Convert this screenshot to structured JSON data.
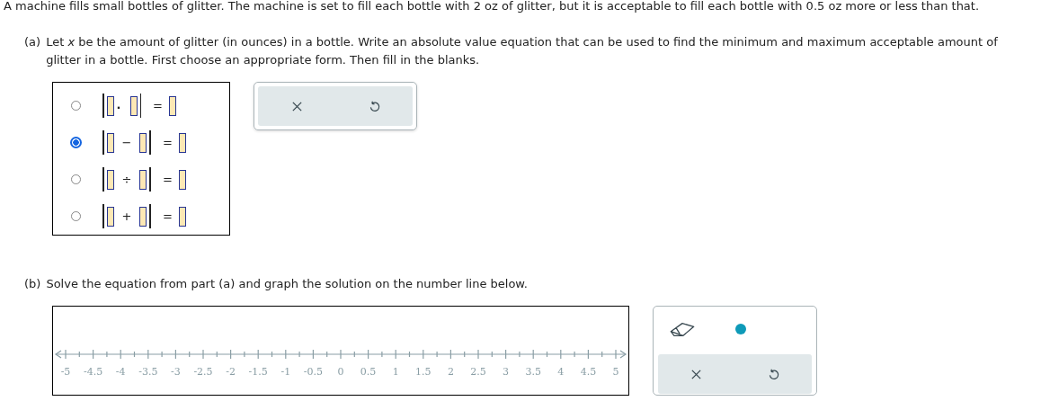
{
  "intro": "A machine fills small bottles of glitter. The machine is set to fill each bottle with 2 oz of glitter, but it is acceptable to fill each bottle with 0.5 oz more or less than that.",
  "part_a": {
    "label": "(a)",
    "text": "Let *x* be the amount of glitter (in ounces) in a bottle. Write an absolute value equation that can be used to find the minimum and maximum acceptable amount of glitter in a bottle. First choose an appropriate form. Then fill in the blanks.",
    "options": [
      {
        "kind": "dot",
        "operator": "·",
        "equals": "=",
        "selected": false
      },
      {
        "kind": "spaced",
        "operator": "−",
        "equals": "=",
        "selected": true
      },
      {
        "kind": "spaced",
        "operator": "÷",
        "equals": "=",
        "selected": false
      },
      {
        "kind": "spaced",
        "operator": "+",
        "equals": "=",
        "selected": false
      }
    ]
  },
  "part_b": {
    "label": "(b)",
    "text": "Solve the equation from part (a) and graph the solution on the number line below.",
    "number_line": {
      "labels": [
        "-5",
        "-4.5",
        "-4",
        "-3.5",
        "-3",
        "-2.5",
        "-2",
        "-1.5",
        "-1",
        "-0.5",
        "0",
        "0.5",
        "1",
        "1.5",
        "2",
        "2.5",
        "3",
        "3.5",
        "4",
        "4.5",
        "5"
      ]
    }
  }
}
